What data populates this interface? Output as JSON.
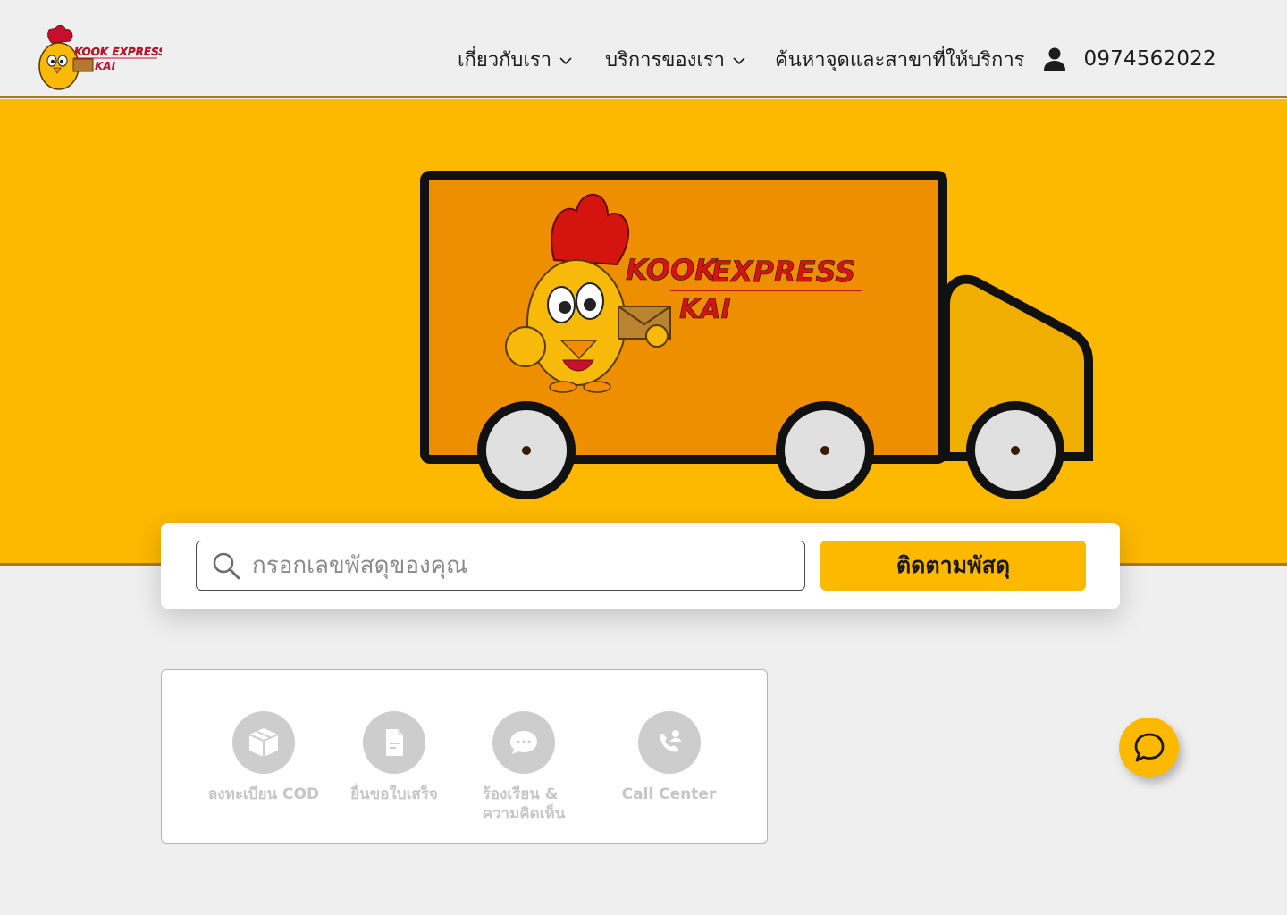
{
  "brand": {
    "name_line1": "KOOK EXPRESS",
    "name_line2": "KAI",
    "color_primary": "#fdb800",
    "color_accent": "#c8102e",
    "color_dark_border": "#a8782a"
  },
  "header": {
    "nav": [
      {
        "label": "เกี่ยวกับเรา",
        "has_dropdown": true
      },
      {
        "label": "บริการของเรา",
        "has_dropdown": true
      },
      {
        "label": "ค้นหาจุดและสาขาที่ให้บริการ",
        "has_dropdown": false
      }
    ],
    "account_icon": "user-icon",
    "phone": "0974562022"
  },
  "hero": {
    "truck_logo_line1_a": "KOOK",
    "truck_logo_line1_b": "EXPRESS",
    "truck_logo_line2": "KAI"
  },
  "tracking": {
    "placeholder": "กรอกเลขพัสดุของคุณ",
    "value": "",
    "button_label": "ติดตามพัสดุ",
    "icon": "search-icon"
  },
  "services": [
    {
      "label": "ลงทะเบียน COD",
      "icon": "box-icon"
    },
    {
      "label": "ยื่นขอใบเสร็จ",
      "icon": "document-icon"
    },
    {
      "label_line1": "ร้องเรียน &",
      "label_line2": "ความคิดเห็น",
      "icon": "chat-bubble-icon"
    },
    {
      "label": "Call Center",
      "icon": "phone-icon"
    }
  ],
  "chat_fab": {
    "icon": "chat-icon"
  }
}
